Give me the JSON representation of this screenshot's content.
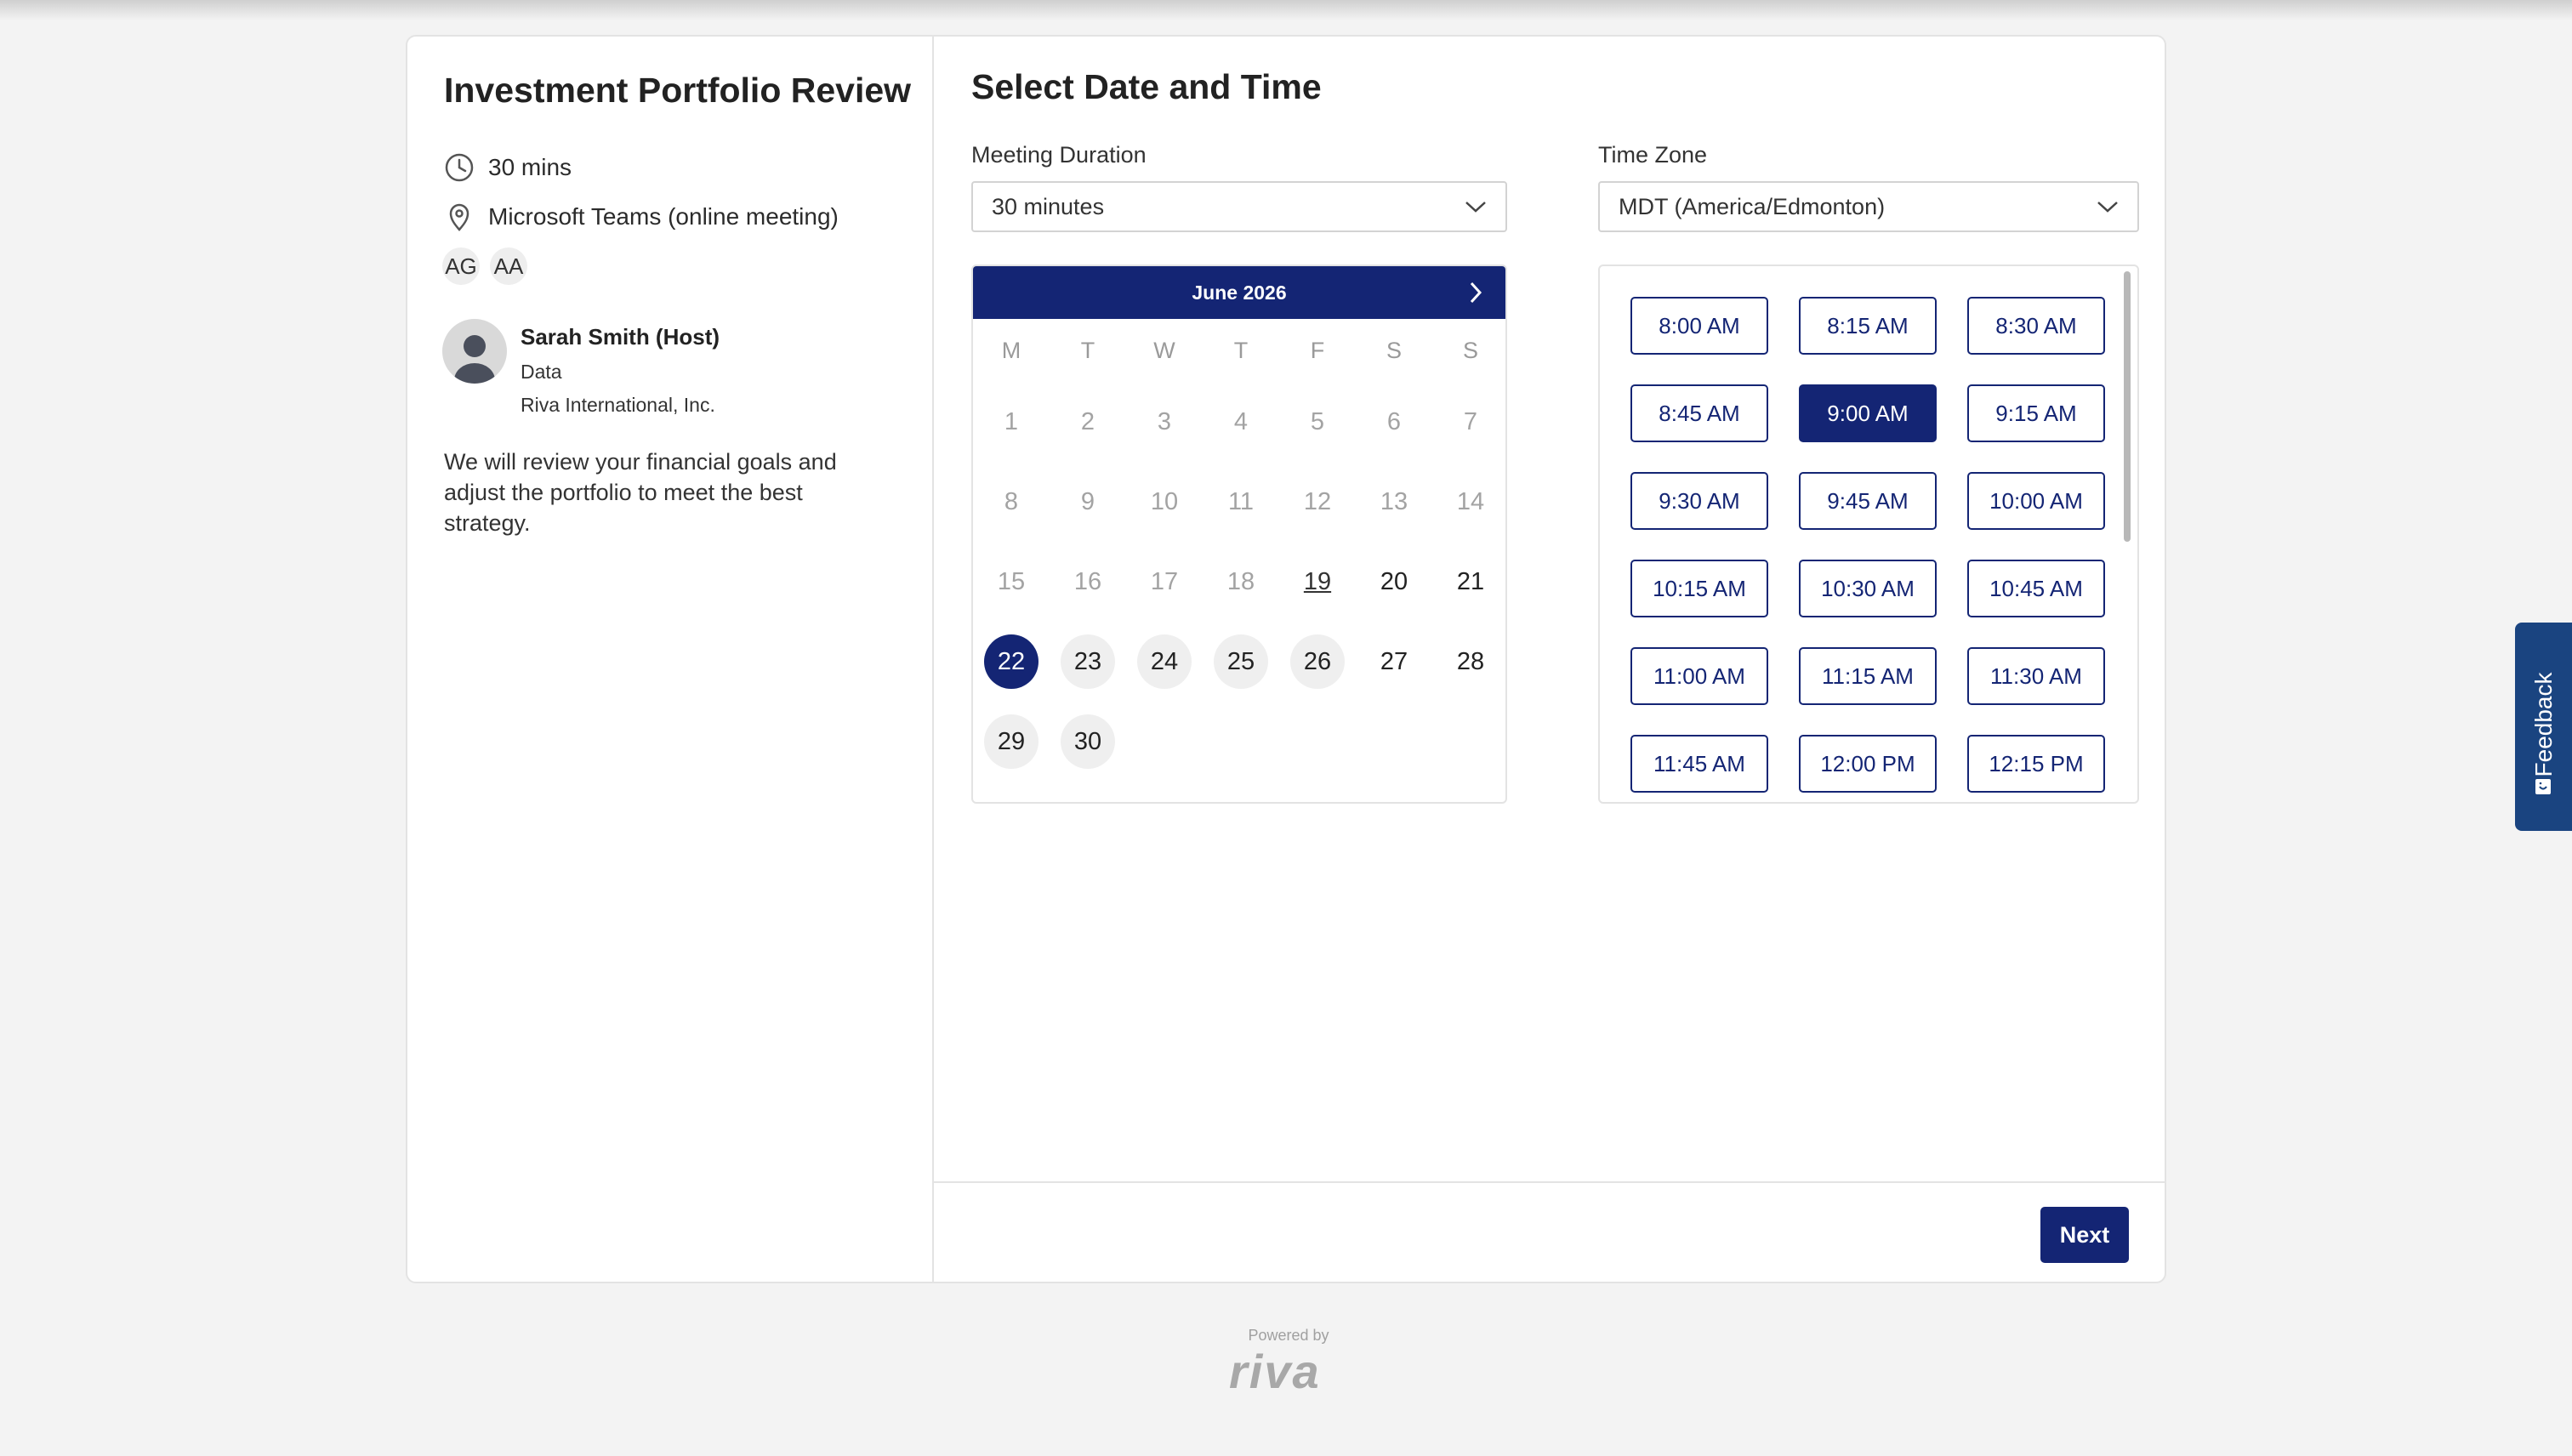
{
  "event": {
    "title": "Investment Portfolio Review",
    "duration": "30 mins",
    "location": "Microsoft Teams (online meeting)",
    "attendees": [
      "AG",
      "AA"
    ],
    "host": {
      "name": "Sarah Smith (Host)",
      "department": "Data",
      "company": "Riva International, Inc."
    },
    "description": "We will review your financial goals and adjust the portfolio to meet the best strategy."
  },
  "scheduler": {
    "title": "Select Date and Time",
    "duration_label": "Meeting Duration",
    "duration_value": "30 minutes",
    "timezone_label": "Time Zone",
    "timezone_value": "MDT (America/Edmonton)",
    "calendar": {
      "month_label": "June 2026",
      "weekdays": [
        "M",
        "T",
        "W",
        "T",
        "F",
        "S",
        "S"
      ],
      "days": [
        {
          "n": "1",
          "state": "past"
        },
        {
          "n": "2",
          "state": "past"
        },
        {
          "n": "3",
          "state": "past"
        },
        {
          "n": "4",
          "state": "past"
        },
        {
          "n": "5",
          "state": "past"
        },
        {
          "n": "6",
          "state": "past"
        },
        {
          "n": "7",
          "state": "past"
        },
        {
          "n": "8",
          "state": "past"
        },
        {
          "n": "9",
          "state": "past"
        },
        {
          "n": "10",
          "state": "past"
        },
        {
          "n": "11",
          "state": "past"
        },
        {
          "n": "12",
          "state": "past"
        },
        {
          "n": "13",
          "state": "past"
        },
        {
          "n": "14",
          "state": "past"
        },
        {
          "n": "15",
          "state": "past"
        },
        {
          "n": "16",
          "state": "past"
        },
        {
          "n": "17",
          "state": "past"
        },
        {
          "n": "18",
          "state": "past"
        },
        {
          "n": "19",
          "state": "today"
        },
        {
          "n": "20",
          "state": "normal"
        },
        {
          "n": "21",
          "state": "normal"
        },
        {
          "n": "22",
          "state": "selected"
        },
        {
          "n": "23",
          "state": "avail"
        },
        {
          "n": "24",
          "state": "avail"
        },
        {
          "n": "25",
          "state": "avail"
        },
        {
          "n": "26",
          "state": "avail"
        },
        {
          "n": "27",
          "state": "normal"
        },
        {
          "n": "28",
          "state": "normal"
        },
        {
          "n": "29",
          "state": "avail"
        },
        {
          "n": "30",
          "state": "avail"
        }
      ]
    },
    "time_slots": [
      "8:00 AM",
      "8:15 AM",
      "8:30 AM",
      "8:45 AM",
      "9:00 AM",
      "9:15 AM",
      "9:30 AM",
      "9:45 AM",
      "10:00 AM",
      "10:15 AM",
      "10:30 AM",
      "10:45 AM",
      "11:00 AM",
      "11:15 AM",
      "11:30 AM",
      "11:45 AM",
      "12:00 PM",
      "12:15 PM"
    ],
    "selected_slot": "9:00 AM",
    "next_label": "Next"
  },
  "footer": {
    "powered_by": "Powered by",
    "brand": "riva"
  },
  "feedback_label": "Feedback",
  "colors": {
    "primary": "#142574",
    "feedback_tab": "#1a4480",
    "muted_text": "#a3a3a3"
  }
}
